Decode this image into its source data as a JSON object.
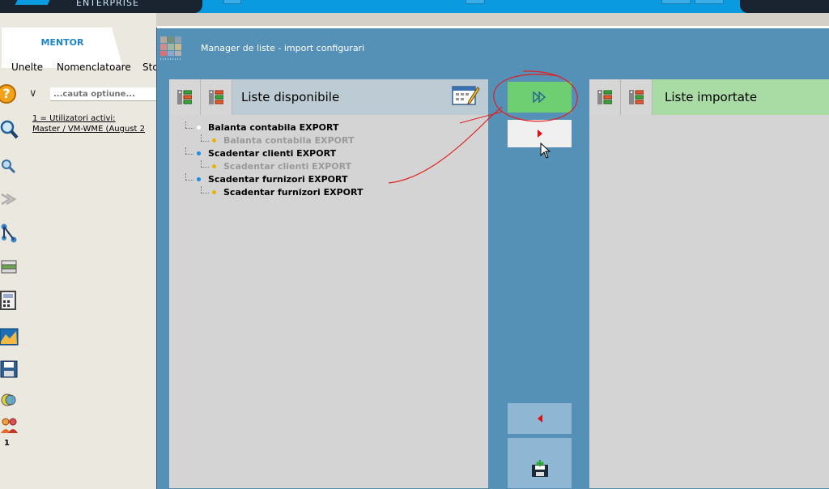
{
  "app": {
    "brand_text": "ENTERPRISE"
  },
  "left_panel": {
    "tab_label": "MENTOR",
    "menu": [
      "Unelte",
      "Nomenclatoare",
      "Sto"
    ],
    "search_placeholder": "...cauta optiune...",
    "users_line1": "1  =  Utilizatori  activi:",
    "users_line2": "Master   /  VM-WME  (August  2",
    "icons": [
      "search-icon",
      "zoom-icon",
      "workflow-icon",
      "network-icon",
      "stack-icon",
      "calculator-icon",
      "chart-icon",
      "save-disk-icon",
      "globe-icon",
      "users-icon"
    ],
    "users_count": "1"
  },
  "dialog": {
    "title": "Manager de liste  - import configurari",
    "left_list": {
      "title": "Liste disponibile",
      "items": [
        {
          "label": "Balanta contabila EXPORT",
          "level": 0,
          "bold": true,
          "bullet_color": "#ffffff"
        },
        {
          "label": "Balanta contabila EXPORT",
          "level": 1,
          "bold": true,
          "muted": true,
          "bullet_color": "#e8b400"
        },
        {
          "label": "Scadentar clienti EXPORT",
          "level": 0,
          "bold": true,
          "bullet_color": "#1a8fe0"
        },
        {
          "label": "Scadentar clienti EXPORT",
          "level": 1,
          "bold": true,
          "muted": true,
          "bullet_color": "#e8b400"
        },
        {
          "label": "Scadentar furnizori EXPORT",
          "level": 0,
          "bold": true,
          "bullet_color": "#1a8fe0"
        },
        {
          "label": "Scadentar furnizori EXPORT",
          "level": 1,
          "bold": true,
          "muted": false,
          "bullet_color": "#e8b400"
        }
      ]
    },
    "right_list": {
      "title": "Liste importate"
    }
  },
  "colors": {
    "dialog_bg": "#5590b7",
    "import_all_green": "#6dcf71",
    "right_header_green": "#a8dca4",
    "left_header_blue": "#bccbd4",
    "annotation_red": "#e02020"
  }
}
